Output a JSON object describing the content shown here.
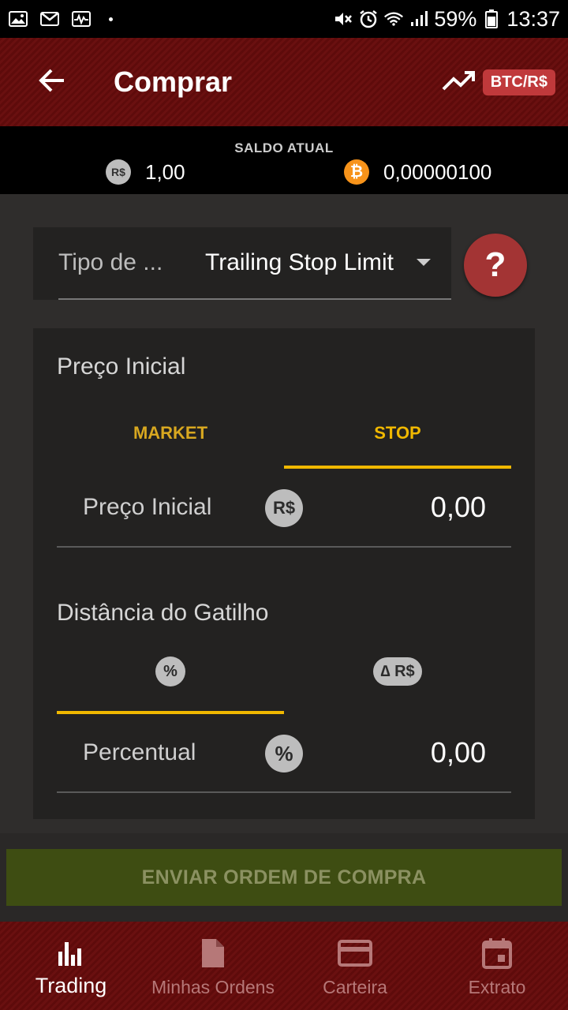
{
  "status_bar": {
    "battery": "59%",
    "time": "13:37",
    "icons": [
      "image-icon",
      "gmail-icon",
      "activity-icon",
      "mute-icon",
      "alarm-icon",
      "wifi-icon",
      "signal-icon",
      "battery-icon"
    ]
  },
  "app_bar": {
    "title": "Comprar",
    "pair": "BTC/R$",
    "icons": [
      "back-arrow-icon",
      "trending-up-icon"
    ]
  },
  "balance": {
    "label": "SALDO ATUAL",
    "brl_symbol": "R$",
    "brl_value": "1,00",
    "btc_symbol": "₿",
    "btc_value": "0,00000100"
  },
  "order_type": {
    "label": "Tipo de ...",
    "value": "Trailing Stop Limit",
    "help": "?"
  },
  "initial_price": {
    "title": "Preço Inicial",
    "tabs": [
      "MARKET",
      "STOP"
    ],
    "active_tab": "STOP",
    "field_label": "Preço Inicial",
    "field_icon": "R$",
    "field_value": "0,00"
  },
  "trigger_distance": {
    "title": "Distância do Gatilho",
    "tabs": [
      "%",
      "∆ R$"
    ],
    "active_tab": "%",
    "field_label": "Percentual",
    "field_icon": "%",
    "field_value": "0,00"
  },
  "submit": {
    "label": "ENVIAR ORDEM DE COMPRA",
    "enabled": false
  },
  "bottom_nav": {
    "items": [
      {
        "label": "Trading",
        "icon": "bar-chart-icon",
        "active": true
      },
      {
        "label": "Minhas Ordens",
        "icon": "document-icon",
        "active": false
      },
      {
        "label": "Carteira",
        "icon": "credit-card-icon",
        "active": false
      },
      {
        "label": "Extrato",
        "icon": "calendar-icon",
        "active": false
      }
    ]
  },
  "colors": {
    "accent": "#f0b800",
    "brand_red": "#6a1010",
    "help_red": "#a33434",
    "submit_disabled": "#3e4d12"
  }
}
